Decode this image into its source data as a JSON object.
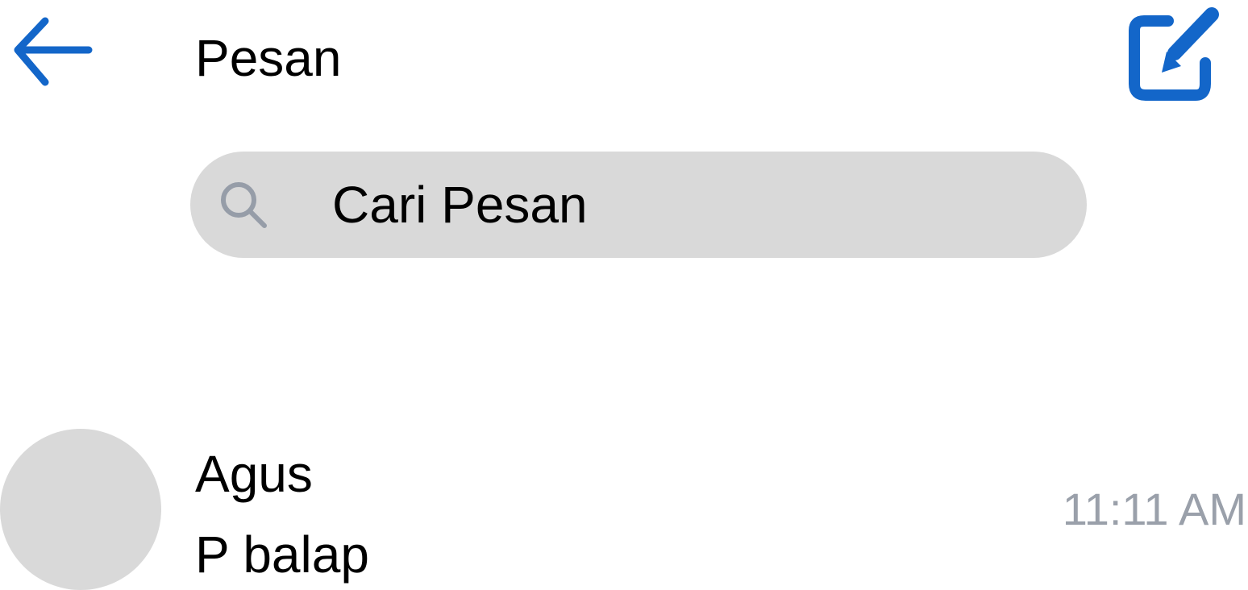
{
  "header": {
    "title": "Pesan",
    "back_icon": "arrow-left-icon",
    "compose_icon": "compose-icon",
    "accent_color": "#1366c9"
  },
  "search": {
    "placeholder": "Cari Pesan",
    "value": "",
    "icon": "search-icon",
    "background_color": "#d9d9d9"
  },
  "conversations": [
    {
      "name": "Agus",
      "preview": "P balap",
      "time": "11:11 AM"
    }
  ]
}
